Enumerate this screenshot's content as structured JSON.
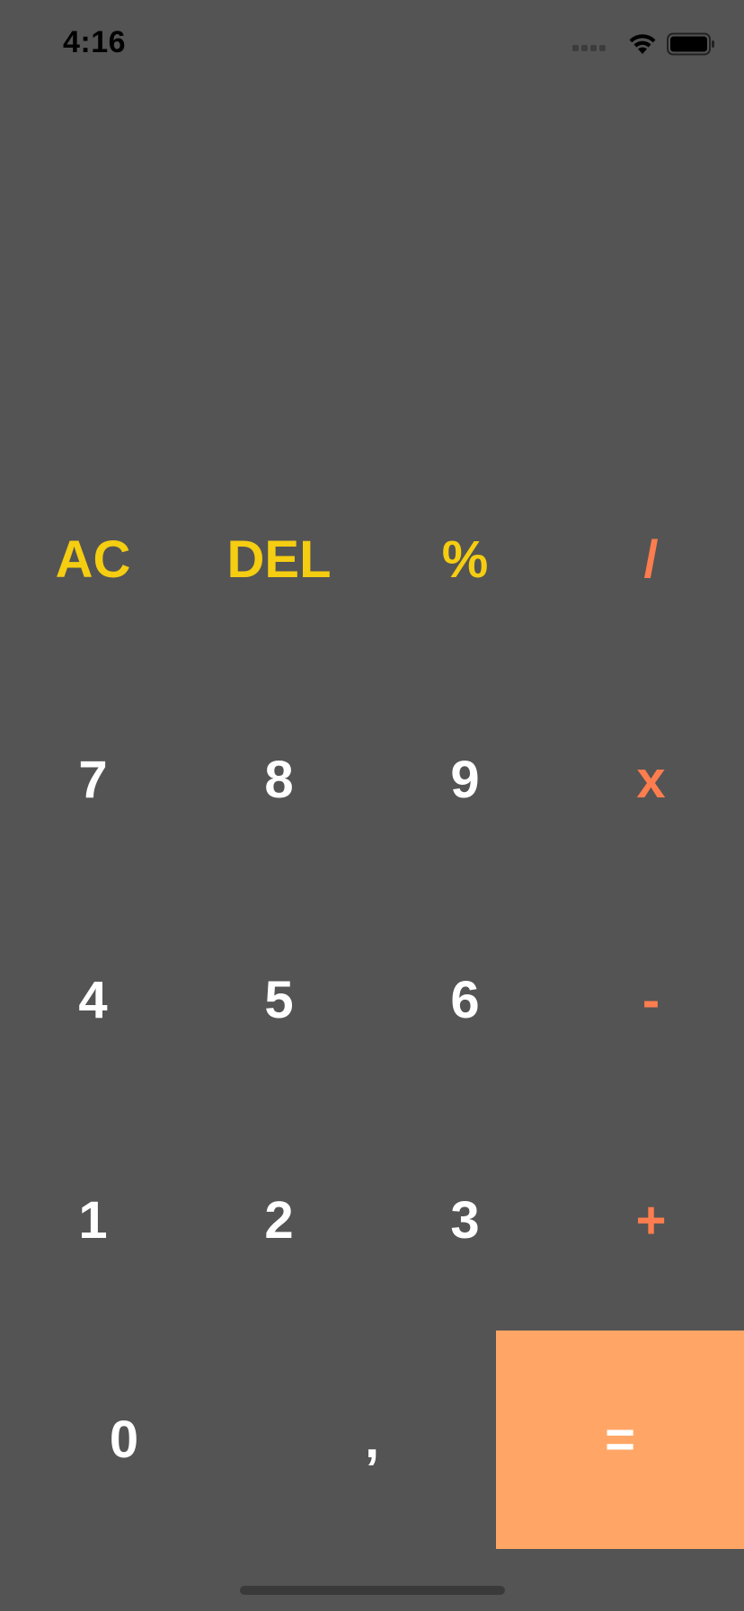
{
  "status_bar": {
    "time": "4:16"
  },
  "keypad": {
    "row1": [
      "AC",
      "DEL",
      "%",
      "/"
    ],
    "row2": [
      "7",
      "8",
      "9",
      "x"
    ],
    "row3": [
      "4",
      "5",
      "6",
      "-"
    ],
    "row4": [
      "1",
      "2",
      "3",
      "+"
    ],
    "row5": [
      "0",
      ",",
      "="
    ]
  },
  "colors": {
    "background": "#545454",
    "function_keys": "#f5cd11",
    "operator_keys": "#fd7d4e",
    "number_keys": "#ffffff",
    "equals_background": "#ffa666"
  }
}
